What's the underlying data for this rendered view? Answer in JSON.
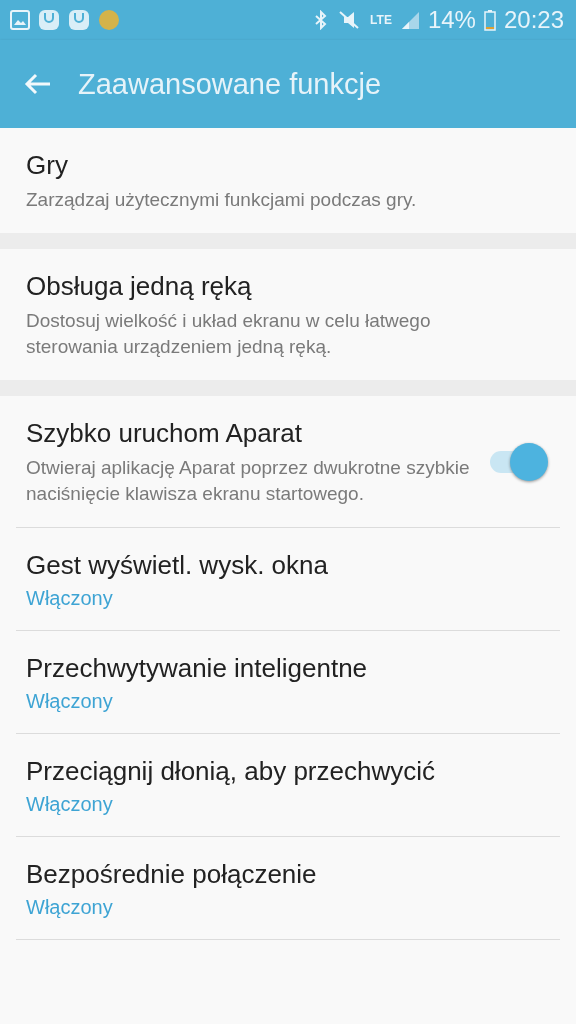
{
  "status_bar": {
    "network": "LTE",
    "battery": "14%",
    "time": "20:23"
  },
  "app_bar": {
    "title": "Zaawansowane funkcje"
  },
  "groups": [
    {
      "items": [
        {
          "kind": "plain",
          "title": "Gry",
          "subtitle": "Zarządzaj użytecznymi funkcjami podczas gry."
        }
      ]
    },
    {
      "items": [
        {
          "kind": "plain",
          "title": "Obsługa jedną ręką",
          "subtitle": "Dostosuj wielkość i układ ekranu w celu łatwego sterowania urządzeniem jedną ręką."
        }
      ]
    },
    {
      "items": [
        {
          "kind": "toggle",
          "title": "Szybko uruchom Aparat",
          "subtitle": "Otwieraj aplikację Aparat poprzez dwukrotne szybkie naciśnięcie klawisza ekranu startowego.",
          "on": true
        },
        {
          "kind": "status",
          "title": "Gest wyświetl. wysk. okna",
          "status": "Włączony"
        },
        {
          "kind": "status",
          "title": "Przechwytywanie inteligentne",
          "status": "Włączony"
        },
        {
          "kind": "status",
          "title": "Przeciągnij dłonią, aby przechwycić",
          "status": "Włączony"
        },
        {
          "kind": "status",
          "title": "Bezpośrednie połączenie",
          "status": "Włączony"
        }
      ]
    }
  ]
}
